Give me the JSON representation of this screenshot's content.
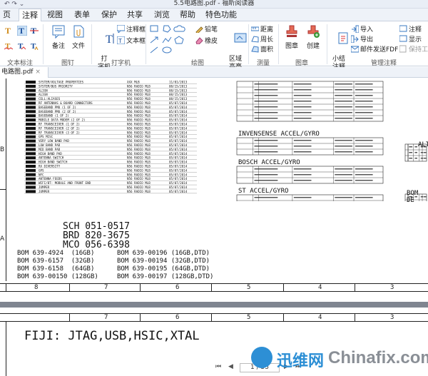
{
  "window": {
    "title": "5.5电路图.pdf - 福昕阅读器",
    "quick_access": "↶ ↷ ⌄"
  },
  "menu": [
    "页",
    "注释",
    "视图",
    "表单",
    "保护",
    "共享",
    "浏览",
    "帮助",
    "特色功能"
  ],
  "menu_active": "注释",
  "ribbon": {
    "text_group": {
      "label": "文本标注"
    },
    "pin_group": {
      "label": "图钉",
      "note": "备注",
      "file": "文件"
    },
    "typewriter_group": {
      "label": "打字机",
      "typewriter": "打\n字机",
      "callout": "注释框",
      "textbox": "文本框"
    },
    "drawing_group": {
      "label": "绘图",
      "pencil": "铅笔",
      "eraser": "橡皮",
      "area_highlight": "区域\n高亮"
    },
    "measure_group": {
      "label": "测量",
      "distance": "距离",
      "perimeter": "周长",
      "area": "面积"
    },
    "stamp_group": {
      "label": "图章",
      "stamp": "图章",
      "create": "创建"
    },
    "manage_group": {
      "label": "管理注释",
      "summary": "小结\n注释",
      "import": "导入",
      "export": "导出",
      "email_pdf": "邮件发送FDF",
      "notes": "注释",
      "show": "显示",
      "keep_tool": "保持工具"
    }
  },
  "doc_tab": "电路图.pdf",
  "page1": {
    "ruler_labels": [
      "8",
      "7",
      "6",
      "5",
      "4",
      "3"
    ],
    "side_labels": [
      "B",
      "A"
    ],
    "sections": [
      "INVENSENSE ACCEL/GYRO",
      "BOSCH ACCEL/GYRO",
      "ST ACCEL/GYRO",
      "ALT",
      "BOM DE"
    ],
    "sch": [
      "SCH 051-0517",
      "BRD 820-3675",
      "MCO 056-6398"
    ],
    "bom_left": [
      "BOM 639-4924  (16GB)",
      "BOM 639-6157  (32GB)",
      "BOM 639-6158  (64GB)",
      "BOM 639-00150 (128GB)"
    ],
    "bom_right": [
      "BOM 639-00196 (16GB,DTD)",
      "BOM 639-00194 (32GB,DTD)",
      "BOM 639-00195 (64GB,DTD)",
      "BOM 639-00197 (128GB,DTD)"
    ],
    "table_rows": [
      {
        "name": "SYSTEM/VOLTAGE PROPERTIES",
        "by": "XXX MLB",
        "date": "11/01/2013"
      },
      {
        "name": "SYSTEM/BUS PRIORITY",
        "by": "N56 RADIO MLB",
        "date": "08/15/2013"
      },
      {
        "name": "ALIGN",
        "by": "N56 RADIO MLB",
        "date": "08/15/2013"
      },
      {
        "name": "ALIGN",
        "by": "N56 RADIO MLB",
        "date": "08/15/2013"
      },
      {
        "name": "CELL:ALIASES",
        "by": "N56 RADIO MLB",
        "date": "08/15/2013"
      },
      {
        "name": "RF ANTENNAS & BOARD CONNECTORS",
        "by": "N56 RADIO MLB",
        "date": "05/07/2014"
      },
      {
        "name": "BASEBAND PMU (1 OF 2)",
        "by": "N56 RADIO MLB",
        "date": "05/07/2014"
      },
      {
        "name": "BASEBAND PMU (2 OF 2)",
        "by": "N56 RADIO MLB",
        "date": "05/07/2014"
      },
      {
        "name": "BASEBAND (1 OF 2)",
        "by": "N56 RADIO MLB",
        "date": "05/07/2014"
      },
      {
        "name": "MOBILE DATA MODEM (2 OF 2)",
        "by": "N56 RADIO MLB",
        "date": "05/07/2014"
      },
      {
        "name": "RF TRANSCEIVER (1 OF 2)",
        "by": "N56 RADIO MLB",
        "date": "05/07/2014"
      },
      {
        "name": "RF TRANSCEIVER (2 OF 2)",
        "by": "N56 RADIO MLB",
        "date": "05/07/2014"
      },
      {
        "name": "RF TRANSCEIVER (3 OF 2)",
        "by": "N56 RADIO MLB",
        "date": "05/07/2014"
      },
      {
        "name": "GPS MISC",
        "by": "N56 RADIO MLB",
        "date": "05/07/2014"
      },
      {
        "name": "VERY LOW BAND PAD",
        "by": "N56 RADIO MLB",
        "date": "05/07/2014"
      },
      {
        "name": "LOW BAND PAD",
        "by": "N56 RADIO MLB",
        "date": "05/07/2014"
      },
      {
        "name": "MID BAND PAD",
        "by": "N56 RADIO MLB",
        "date": "05/07/2014"
      },
      {
        "name": "HIGH BAND PAD",
        "by": "N56 RADIO MLB",
        "date": "05/07/2014"
      },
      {
        "name": "ANTENNA SWITCH",
        "by": "N56 RADIO MLB",
        "date": "05/07/2014"
      },
      {
        "name": "HIGH BAND SWITCH",
        "by": "N56 RADIO MLB",
        "date": "05/07/2014"
      },
      {
        "name": "RX DIVERSITY",
        "by": "N56 RADIO MLB",
        "date": "05/07/2014"
      },
      {
        "name": "GPS",
        "by": "N56 RADIO MLB",
        "date": "05/07/2014"
      },
      {
        "name": "NFC",
        "by": "N56 RADIO MLB",
        "date": "05/07/2014"
      },
      {
        "name": "ANTENNA FEEDS",
        "by": "N56 RADIO MLB",
        "date": "05/07/2014"
      },
      {
        "name": "WIFI/BT: MODULE AND FRONT END",
        "by": "N56 RADIO MLB",
        "date": "05/07/2014"
      },
      {
        "name": "JUMPER",
        "by": "N56 RADIO MLB",
        "date": "05/07/2014"
      },
      {
        "name": "JUMPER",
        "by": "N56 RADIO MLB",
        "date": "05/07/2014"
      }
    ]
  },
  "page2": {
    "ruler_labels": [
      "7",
      "6",
      "5",
      "4",
      "3"
    ],
    "heading": "FIJI: JTAG,USB,HSIC,XTAL"
  },
  "nav": {
    "page": "1 / 55"
  },
  "watermark": {
    "cn": "迅维网",
    "en": "Chinafix.com"
  },
  "colors": {
    "accent": "#2d8fd5",
    "ribbon_bg": "#eef2f8"
  }
}
